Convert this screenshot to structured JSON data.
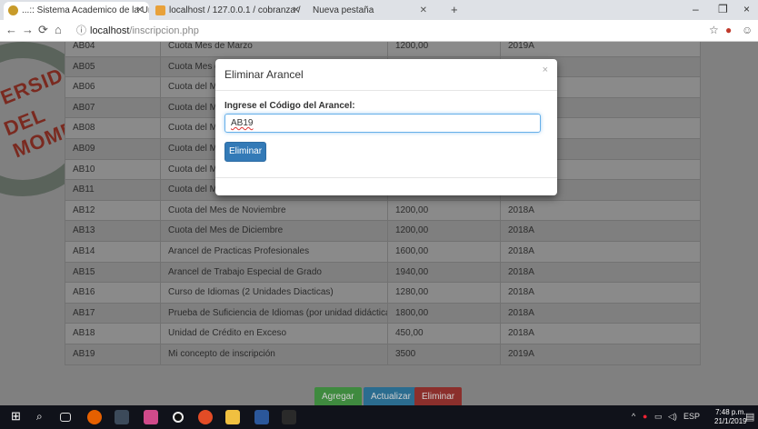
{
  "browser": {
    "tabs": [
      {
        "title": "...:: Sistema Academico de la Un",
        "active": true
      },
      {
        "title": "localhost / 127.0.0.1 / cobranza /",
        "active": false
      },
      {
        "title": "Nueva pestaña",
        "active": false
      }
    ],
    "new_tab": "+",
    "url_host": "localhost",
    "url_path": "/inscripcion.php",
    "window_controls": [
      "–",
      "❐",
      "×"
    ]
  },
  "logo": {
    "line1": "ERSIDAD",
    "line2": "DEL MOMBOY"
  },
  "table": {
    "rows": [
      {
        "code": "AB04",
        "concept": "Cuota Mes de Marzo",
        "amount": "1200,00",
        "period": "2019A"
      },
      {
        "code": "AB05",
        "concept": "Cuota Mes de",
        "amount": "",
        "period": ""
      },
      {
        "code": "AB06",
        "concept": "Cuota del Mes",
        "amount": "",
        "period": ""
      },
      {
        "code": "AB07",
        "concept": "Cuota del Mes",
        "amount": "",
        "period": ""
      },
      {
        "code": "AB08",
        "concept": "Cuota del Mes",
        "amount": "",
        "period": ""
      },
      {
        "code": "AB09",
        "concept": "Cuota del Mes",
        "amount": "",
        "period": ""
      },
      {
        "code": "AB10",
        "concept": "Cuota del Mes",
        "amount": "",
        "period": ""
      },
      {
        "code": "AB11",
        "concept": "Cuota del Mes de Octubre",
        "amount": "1200,00",
        "period": "2018A"
      },
      {
        "code": "AB12",
        "concept": "Cuota del Mes de Noviembre",
        "amount": "1200,00",
        "period": "2018A"
      },
      {
        "code": "AB13",
        "concept": "Cuota del Mes de Diciembre",
        "amount": "1200,00",
        "period": "2018A"
      },
      {
        "code": "AB14",
        "concept": "Arancel de Practicas Profesionales",
        "amount": "1600,00",
        "period": "2018A"
      },
      {
        "code": "AB15",
        "concept": "Arancel de Trabajo Especial de Grado",
        "amount": "1940,00",
        "period": "2018A"
      },
      {
        "code": "AB16",
        "concept": "Curso de Idiomas (2 Unidades Diacticas)",
        "amount": "1280,00",
        "period": "2018A"
      },
      {
        "code": "AB17",
        "concept": "Prueba de Suficiencia de Idiomas (por unidad didáctica)",
        "amount": "1800,00",
        "period": "2018A"
      },
      {
        "code": "AB18",
        "concept": "Unidad de Crédito en Exceso",
        "amount": "450,00",
        "period": "2018A"
      },
      {
        "code": "AB19",
        "concept": "Mi concepto de inscripción",
        "amount": "3500",
        "period": "2019A"
      }
    ]
  },
  "actions": {
    "add": "Agregar",
    "update": "Actualizar",
    "delete": "Eliminar"
  },
  "modal": {
    "title": "Eliminar Arancel",
    "close": "×",
    "label": "Ingrese el Código del Arancel:",
    "input_value": "AB19",
    "button": "Eliminar"
  },
  "taskbar": {
    "language": "ESP",
    "time": "7:48 p.m.",
    "date": "21/1/2019"
  },
  "colors": {
    "add": "#3f8a3f",
    "update": "#2b6c8f",
    "delete": "#8b2f2c",
    "primary": "#337ab7"
  }
}
